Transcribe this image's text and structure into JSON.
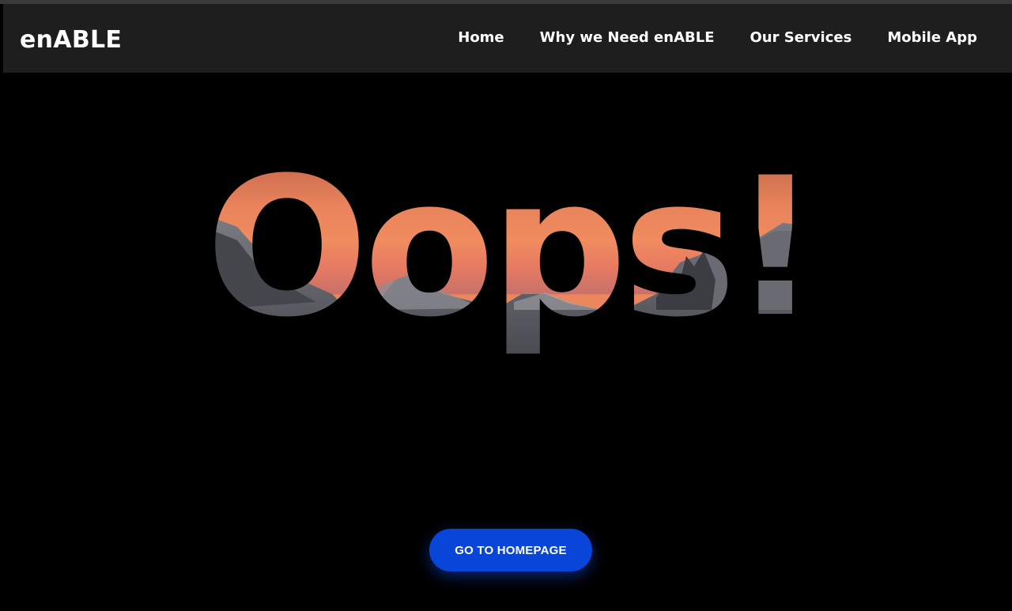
{
  "brand": "enABLE",
  "nav": {
    "items": [
      {
        "label": "Home"
      },
      {
        "label": "Why we Need enABLE"
      },
      {
        "label": "Our Services"
      },
      {
        "label": "Mobile App"
      }
    ]
  },
  "hero": {
    "headline": "Oops!",
    "fill_image": "sunset-mountains",
    "button_label": "GO TO HOMEPAGE"
  },
  "colors": {
    "background": "#000000",
    "navbar": "#1e1e1e",
    "button": "#0a45d9",
    "sky_top": "#d86f4a",
    "sky_mid": "#f08a5e",
    "mountain": "#56575d"
  }
}
